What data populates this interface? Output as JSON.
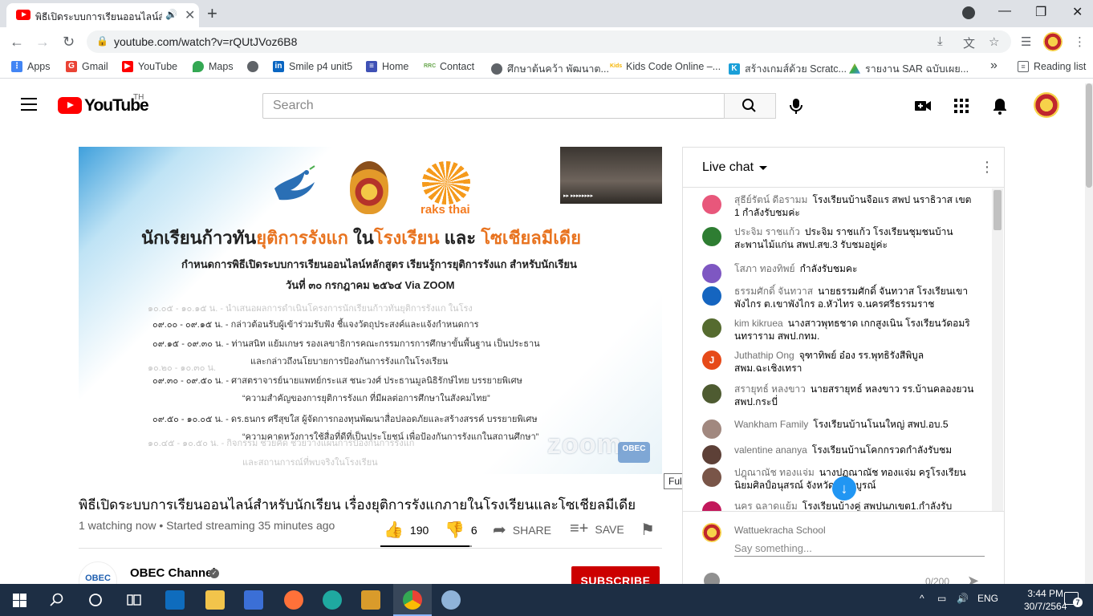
{
  "browser": {
    "tab_title": "พิธีเปิดระบบการเรียนออนไลน์สำห",
    "tab_speaker": "🔊",
    "tab_close": "✕",
    "new_tab": "+",
    "url": "youtube.com/watch?v=rQUtJVoz6B8",
    "back": "←",
    "forward": "→",
    "reload": "↻",
    "window_minimize": "—",
    "window_restore": "❐",
    "window_close": "✕",
    "omnibox_icons": {
      "download": "⤓",
      "translate": "文",
      "star": "☆",
      "reading": "☰"
    }
  },
  "bookmarks": [
    {
      "label": "Apps",
      "icon": "apps-grid-icon",
      "color": "#4285f4"
    },
    {
      "label": "Gmail",
      "icon": "google-icon",
      "color": "#ea4335"
    },
    {
      "label": "YouTube",
      "icon": "youtube-icon",
      "color": "#ff0000"
    },
    {
      "label": "Maps",
      "icon": "maps-pin-icon",
      "color": "#34a853"
    },
    {
      "label": "",
      "icon": "globe-icon",
      "color": "#5f6368"
    },
    {
      "label": "Smile p4 unit5",
      "icon": "linkedin-icon",
      "color": "#0a66c2"
    },
    {
      "label": "Home",
      "icon": "page-icon",
      "color": "#3f51b5"
    },
    {
      "label": "Contact",
      "icon": "rrc-icon",
      "color": "#6aa84f"
    },
    {
      "label": "ศึกษาต้นคว้า พัฒนาต...",
      "icon": "globe-icon",
      "color": "#5f6368"
    },
    {
      "label": "Kids Code Online –...",
      "icon": "kids-icon",
      "color": "#f4b400"
    },
    {
      "label": "สร้างเกมส์ด้วย Scratc...",
      "icon": "k-icon",
      "color": "#1a9fd8"
    },
    {
      "label": "รายงาน SAR ฉบับเผย...",
      "icon": "drive-icon",
      "color": "#fbbc04"
    }
  ],
  "bookmarks_more": "»",
  "reading_list": "Reading list",
  "youtube": {
    "logo_text": "YouTube",
    "country": "TH",
    "search_placeholder": "Search",
    "search_icon": "⌕",
    "mic_icon": "🎤",
    "create_icon": "▶",
    "apps_icon": "⋮⋮⋮",
    "bell_icon": "🔔"
  },
  "video_slide": {
    "raks_thai": "raks thai",
    "title_a": "นักเรียนก้าวทัน",
    "title_b": "ยุติการรังแก",
    "title_c": " ใน",
    "title_d": "โรงเรียน",
    "title_e": " และ ",
    "title_f": "โซเชียลมีเดีย",
    "subtitle": "กำหนดการพิธีเปิดระบบการเรียนออนไลน์หลักสูตร เรียนรู้การยุติการรังแก สำหรับนักเรียน",
    "date": "วันที่ ๓๐ กรกฎาคม ๒๕๖๔ Via ZOOM",
    "lines": [
      "๐๙.๐๐ - ๐๙.๑๕ น.  -  กล่าวต้อนรับผู้เข้าร่วมรับฟัง ชี้แจงวัตถุประสงค์และแจ้งกำหนดการ",
      "๐๙.๑๕ - ๐๙.๓๐ น.  -  ท่านสนิท แย้มเกษร รองเลขาธิการคณะกรรมการการศึกษาขั้นพื้นฐาน เป็นประธาน",
      "และกล่าวถึงนโยบายการป้องกันการรังแกในโรงเรียน",
      "๐๙.๓๐ - ๐๙.๕๐ น.  -  ศาสตราจารย์นายแพทย์กระแส ชนะวงศ์ ประธานมูลนิธิรักษ์ไทย บรรยายพิเศษ",
      "“ความสำคัญของการยุติการรังแก ที่มีผลต่อการศึกษาในสังคมไทย”",
      "๐๙.๕๐ - ๑๐.๐๕ น.  -  ดร.ธนกร ศรีสุขใส ผู้จัดการกองทุนพัฒนาสื่อปลอดภัยและสร้างสรรค์ บรรยายพิเศษ",
      "“ความคาดหวังการใช้สื่อที่ดีที่เป็นประโยชน์ เพื่อป้องกันการรังแกในสถานศึกษา”"
    ],
    "ghost_lines": [
      "๑๐.๐๕ - ๑๐.๑๕ น.  -  นำเสนอผลการดำเนินโครงการนักเรียนก้าวทันยุติการรังแก ในโรง",
      "๑๐.๒๐ - ๑๐.๓๐ น.",
      "๑๐.๔๕ - ๑๐.๕๐ น.  -  กิจกรรม ช่วยคิด ช่วยวางแผนการป้องกันการรังแก",
      "และสถานการณ์ที่พบจริงในโรงเรียน"
    ],
    "zoom_wm": "zoom",
    "obec_wm": "OBEC",
    "cam_label": "▸▸ ▸▸▸▸▸▸▸▸"
  },
  "tooltip": "Full screen (f)",
  "video": {
    "title": "พิธีเปิดระบบการเรียนออนไลน์สำหรับนักเรียน เรื่องยุติการรังแกภายในโรงเรียนและโซเชียลมีเดีย",
    "meta": "1 watching now • Started streaming 35 minutes ago",
    "likes": "190",
    "dislikes": "6",
    "share": "SHARE",
    "save": "SAVE",
    "like_ratio": 0.97,
    "channel_name": "OBEC Channel",
    "channel_avatar": "OBEC",
    "verified": "✓",
    "subscribe": "SUBSCRIBE"
  },
  "chat": {
    "header": "Live chat",
    "more": "⋮",
    "messages": [
      {
        "author": "สุธีย์รัตน์ ดีอรามม",
        "text": "โรงเรียนบ้านจือแร สพป นราธิวาส เขต 1 กำลังรับชมค่ะ",
        "color": "#e8577b",
        "initial": ""
      },
      {
        "author": "ประจิม ราชแก้ว",
        "text": "ประจิม ราชแก้ว โรงเรียนชุมชนบ้านสะพานไม้แก่น สพป.สข.3 รับชมอยู่ค่ะ",
        "color": "#2e7d32",
        "initial": ""
      },
      {
        "author": "โสภา ทองทิพย์",
        "text": "กำลังรับชมคะ",
        "color": "#7e57c2",
        "initial": ""
      },
      {
        "author": "ธรรมศักดิ์ จันทวาส",
        "text": "นายธรรมศักดิ์ จันทวาส โรงเรียนเขาพังไกร ต.เขาพังไกร อ.หัวไทร จ.นครศรีธรรมราช",
        "color": "#1565c0",
        "initial": ""
      },
      {
        "author": "kim kikruea",
        "text": "นางสาวพุทธชาด เกกสูงเนิน โรงเรียนวัดอมรินทราราม สพป.กทม.",
        "color": "#556b2f",
        "initial": ""
      },
      {
        "author": "Juthathip Ong",
        "text": "จุฑาทิพย์ อ๋อง รร.พุทธิรังสีพิบูล สพม.ฉะเชิงเทรา",
        "color": "#e64a19",
        "initial": "J"
      },
      {
        "author": "สรายุทธ์ หลงขาว",
        "text": "นายสรายุทธ์ หลงขาว รร.บ้านคลองยวน สพป.กระบี่",
        "color": "#4e5b31",
        "initial": ""
      },
      {
        "author": "Wankham Family",
        "text": "โรงเรียนบ้านโนนใหญ่ สพป.อบ.5",
        "color": "#a1887f",
        "initial": ""
      },
      {
        "author": "valentine ananya",
        "text": "โรงเรียนบ้านโคกกรวดกำลังรับชม",
        "color": "#5d4037",
        "initial": ""
      },
      {
        "author": "ปฎุณาณัช ทองแจ่ม",
        "text": "นางปฏุณาณัช ทองแจ่ม ครูโรงเรียนนิยมศิลป์อนุสรณ์ จังหวัดเพชรบูรณ์",
        "color": "#795548",
        "initial": ""
      },
      {
        "author": "นคร ฉลาดแย้ม",
        "text": "โรงเรียนบ้างคู่ สพปนภเขต1.กำลังรับ",
        "color": "#c2185b",
        "initial": ""
      }
    ],
    "jump_down": "↓",
    "me_name": "Wattuekracha School",
    "input_placeholder": "Say something...",
    "counter": "0/200",
    "send": "➤"
  },
  "taskbar": {
    "lang": "ENG",
    "time": "3:44 PM",
    "date": "30/7/2564",
    "notifications": "7",
    "tray_up": "^",
    "tray_net": "▭",
    "tray_vol": "🔊"
  }
}
